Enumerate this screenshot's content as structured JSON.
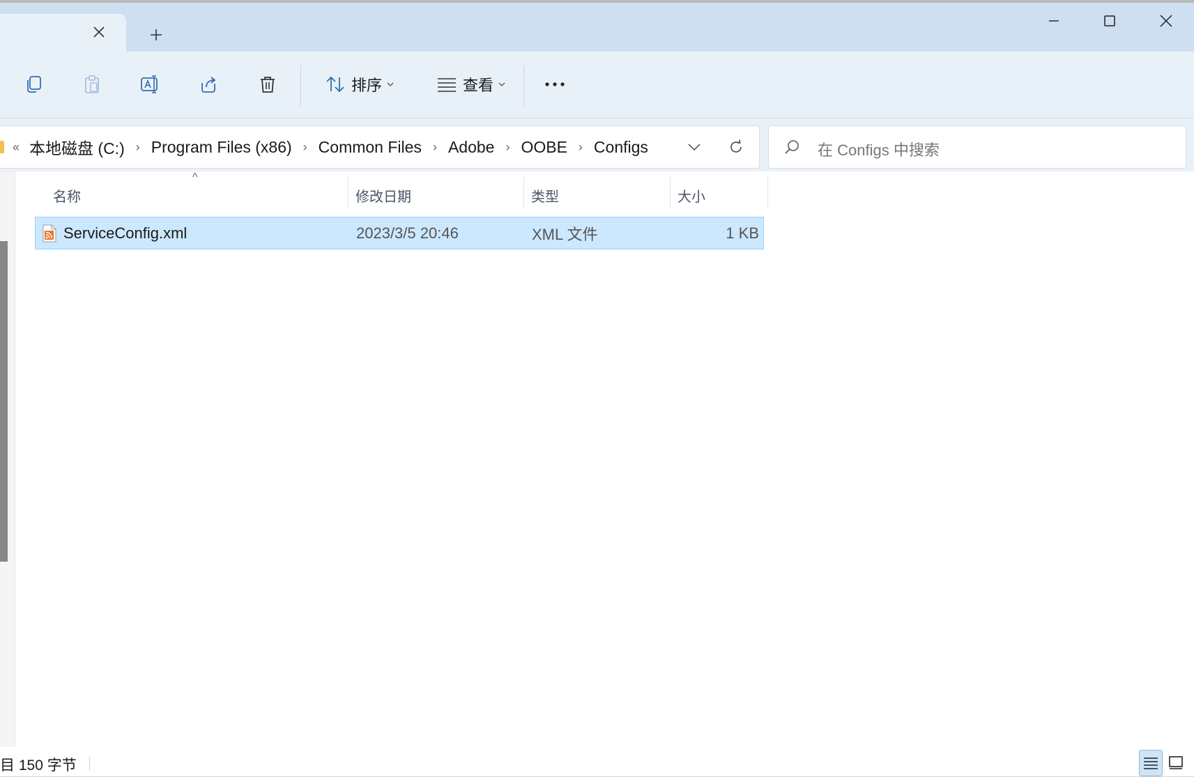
{
  "window": {
    "tab_close_icon": "close-icon",
    "new_tab_icon": "plus-icon",
    "controls": [
      "minimize-icon",
      "maximize-icon",
      "close-icon"
    ]
  },
  "toolbar": {
    "buttons": [
      {
        "icon": "copy-icon"
      },
      {
        "icon": "paste-icon",
        "disabled": true
      },
      {
        "icon": "rename-icon"
      },
      {
        "icon": "share-icon"
      },
      {
        "icon": "delete-icon"
      }
    ],
    "sort_label": "排序",
    "view_label": "查看",
    "more_icon": "more-icon"
  },
  "address": {
    "overflow": "«",
    "crumbs": [
      "本地磁盘 (C:)",
      "Program Files (x86)",
      "Common Files",
      "Adobe",
      "OOBE",
      "Configs"
    ],
    "separator": "›"
  },
  "search": {
    "placeholder": "在 Configs 中搜索"
  },
  "columns": {
    "name": "名称",
    "modified": "修改日期",
    "type": "类型",
    "size": "大小"
  },
  "files": [
    {
      "name": "ServiceConfig.xml",
      "modified": "2023/3/5 20:46",
      "type": "XML 文件",
      "size": "1 KB",
      "selected": true
    }
  ],
  "status": {
    "text": "目  150 字节"
  },
  "colors": {
    "titlebar": "#cddff0",
    "toolbar": "#e9f1f8",
    "selection": "#cce8ff",
    "selection_border": "#99d1ff",
    "accent": "#0067c0"
  }
}
